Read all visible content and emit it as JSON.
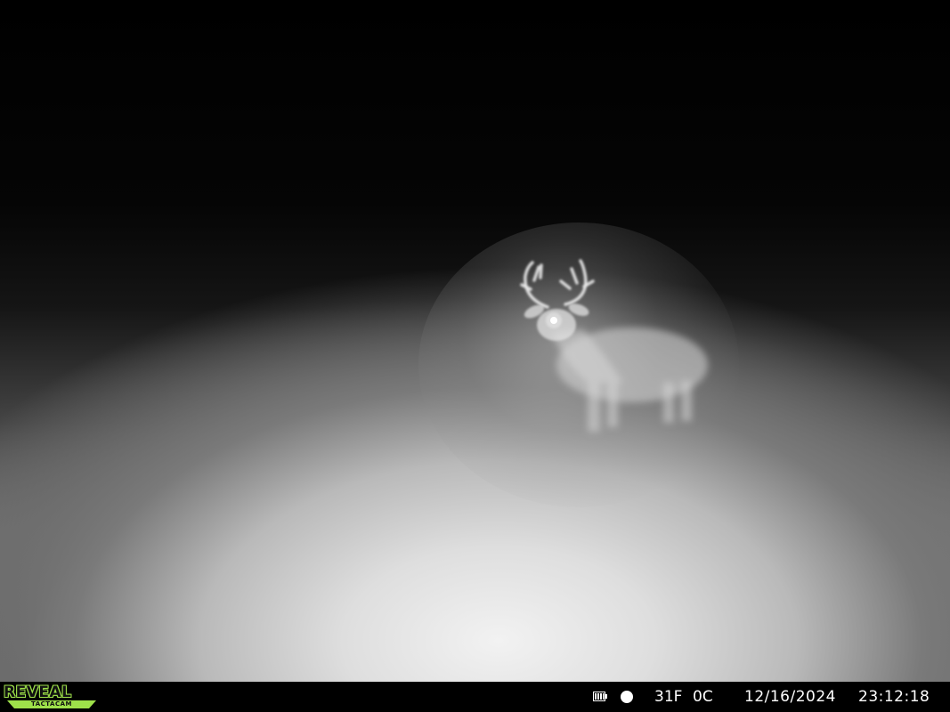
{
  "camera_overlay": {
    "brand_logo_text": "REVEAL",
    "brand_logo_subtext": "TACTACAM",
    "battery_icon": "battery-icon",
    "moon_phase_icon": "full-moon-icon",
    "temperature_f": "31F",
    "temperature_c": "0C",
    "date": "12/16/2024",
    "time": "23:12:18",
    "logo_color": "#9ee14a"
  },
  "scene": {
    "subject_icon": "whitetail-buck-figure"
  }
}
